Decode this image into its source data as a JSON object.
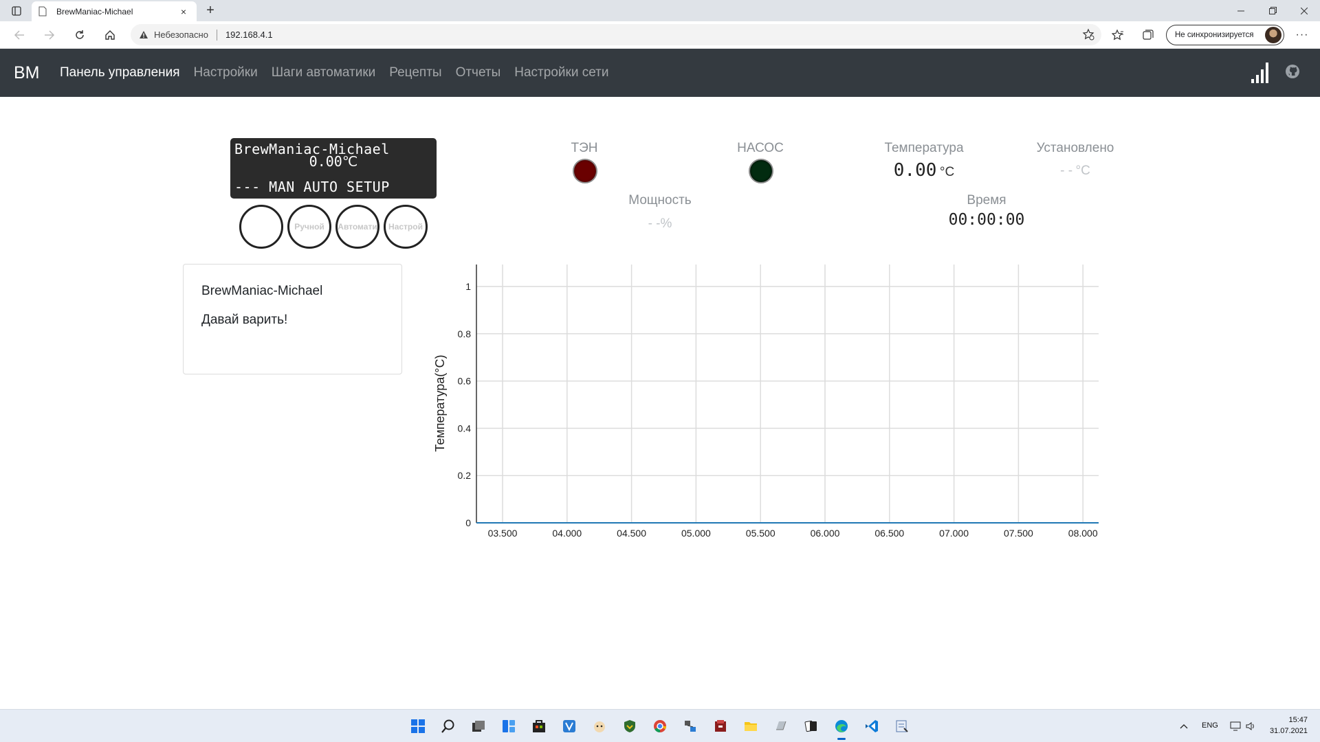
{
  "browser": {
    "tab_title": "BrewManiac-Michael",
    "new_tab": "+",
    "close_tab": "×",
    "security_label": "Небезопасно",
    "url": "192.168.4.1",
    "sync_label": "Не синхронизируется",
    "more": "···"
  },
  "navbar": {
    "brand": "BM",
    "links": [
      {
        "label": "Панель управления",
        "active": true
      },
      {
        "label": "Настройки",
        "active": false
      },
      {
        "label": "Шаги автоматики",
        "active": false
      },
      {
        "label": "Рецепты",
        "active": false
      },
      {
        "label": "Отчеты",
        "active": false
      },
      {
        "label": "Настройки сети",
        "active": false
      }
    ]
  },
  "lcd": {
    "line1": "BrewManiac-Michael",
    "line2": "0.00",
    "line2_unit": "℃",
    "line4": "--- MAN AUTO SETUP",
    "buttons": [
      "",
      "Ручной",
      "Автомати",
      "Настрой"
    ]
  },
  "indicators": {
    "heater_label": "ТЭН",
    "pump_label": "НАСОС",
    "temperature_label": "Температура",
    "temperature_value": "0.00",
    "temperature_unit": "°C",
    "set_label": "Установлено",
    "set_value": "- -",
    "set_unit": "°C",
    "power_label": "Мощность",
    "power_value": "- -",
    "power_unit": "%",
    "time_label": "Время",
    "time_value": "00:00:00",
    "colors": {
      "heater": "#6a0000",
      "pump": "#022b10"
    }
  },
  "card": {
    "title": "BrewManiac-Michael",
    "text": "Давай варить!"
  },
  "chart_data": {
    "type": "line",
    "ylabel": "Температура(°C)",
    "xlabel": "",
    "x_ticks": [
      "03.500",
      "04.000",
      "04.500",
      "05.000",
      "05.500",
      "06.000",
      "06.500",
      "07.000",
      "07.500",
      "08.000"
    ],
    "y_ticks": [
      "0",
      "0.2",
      "0.4",
      "0.6",
      "0.8",
      "1"
    ],
    "ylim": [
      0,
      1
    ],
    "grid": true,
    "series": [
      {
        "values": [
          0,
          0
        ],
        "color": "#1f77b4"
      }
    ]
  },
  "taskbar": {
    "lang": "ENG",
    "time": "15:47",
    "date": "31.07.2021",
    "icons": [
      "windows-start-icon",
      "search-icon",
      "task-view-icon",
      "widgets-icon",
      "store-icon",
      "app-v-icon",
      "app-cat-icon",
      "app-shield-icon",
      "chrome-icon",
      "app-network-icon",
      "app-archive-icon",
      "explorer-folder-icon",
      "app-drive-icon",
      "app-cards-icon",
      "edge-icon",
      "vscode-icon",
      "app-tool-icon"
    ]
  }
}
